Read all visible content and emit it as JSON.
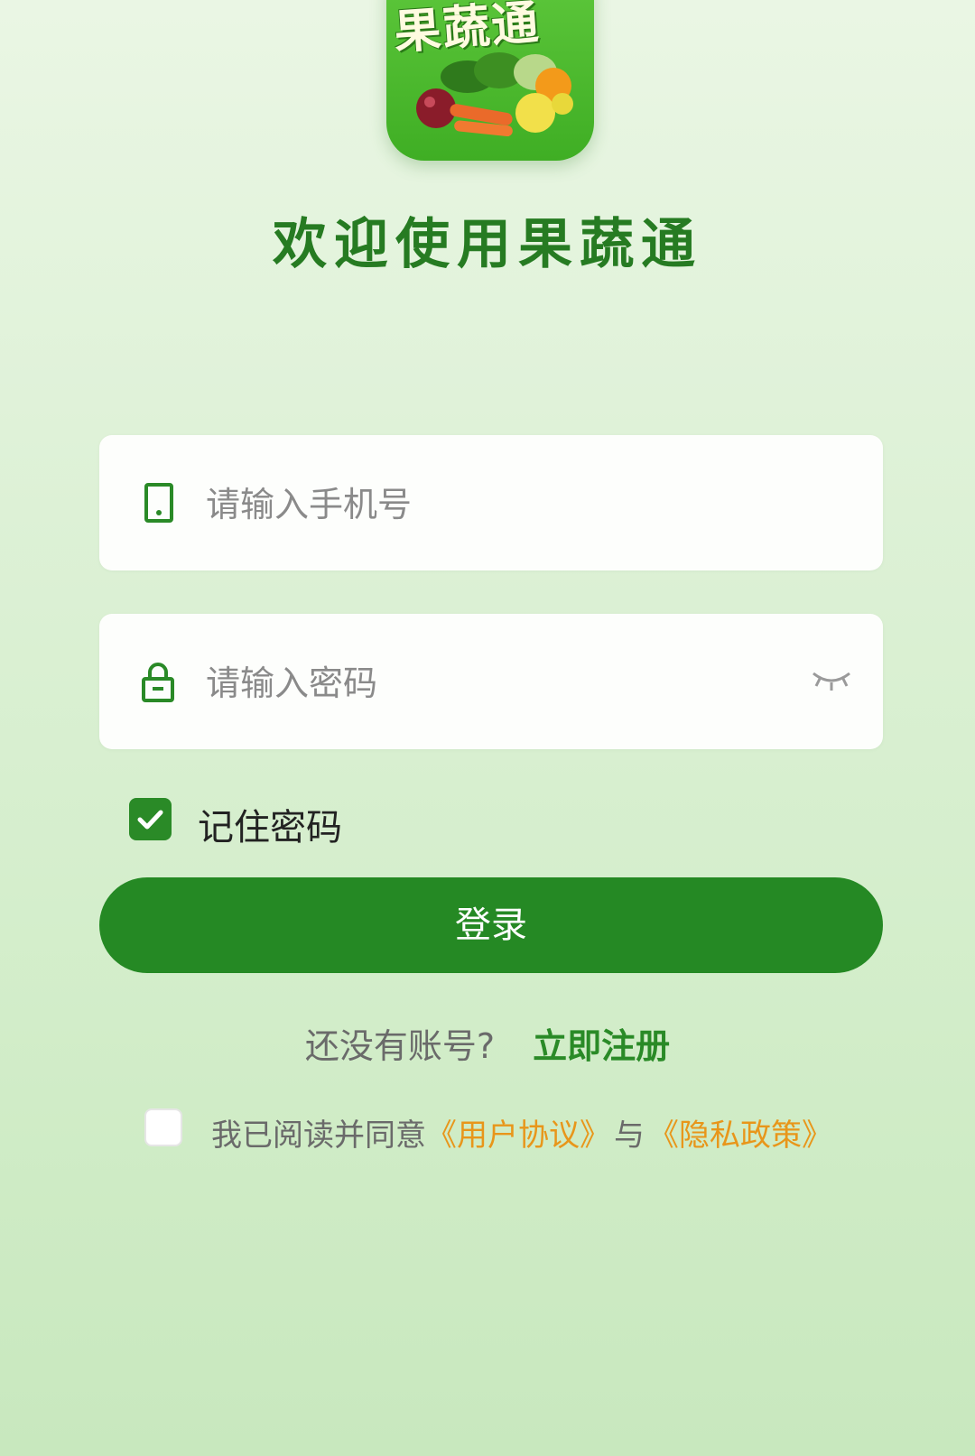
{
  "app": {
    "logo_text": "果蔬通",
    "welcome_title": "欢迎使用果蔬通"
  },
  "form": {
    "phone_placeholder": "请输入手机号",
    "password_placeholder": "请输入密码",
    "remember_label": "记住密码",
    "remember_checked": true,
    "login_label": "登录"
  },
  "register": {
    "question": "还没有账号?",
    "link": "立即注册"
  },
  "agreement": {
    "checked": false,
    "prefix": "我已阅读并同意",
    "user_agreement": "《用户协议》",
    "conjunction": "与",
    "privacy_policy": "《隐私政策》"
  },
  "colors": {
    "primary_green": "#258924",
    "link_orange": "#e8961a",
    "title_green": "#267b22"
  },
  "icons": [
    "phone-icon",
    "lock-icon",
    "eye-closed-icon",
    "checkmark-icon"
  ]
}
